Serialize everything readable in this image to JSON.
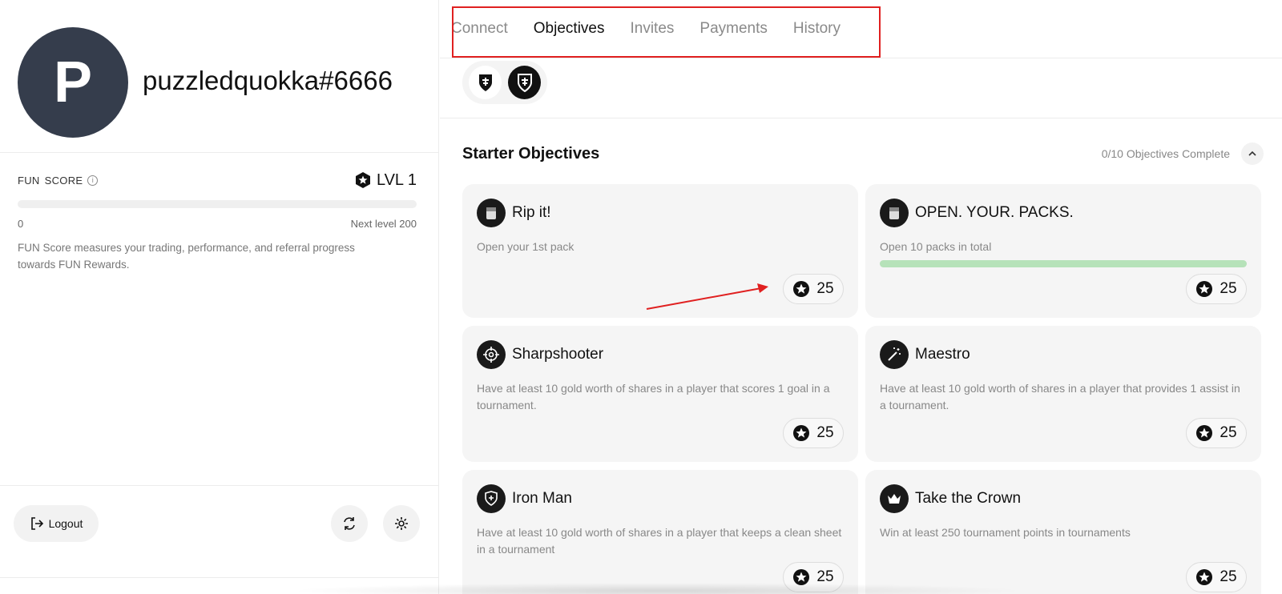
{
  "profile": {
    "avatar_letter": "P",
    "username": "puzzledquokka#6666"
  },
  "fun_score": {
    "label_word1": "FUN",
    "label_word2": "SCORE",
    "level": "LVL 1",
    "min": "0",
    "next_level": "Next level 200",
    "progress_fraction": 0,
    "description": "FUN Score measures your trading, performance, and referral progress towards FUN Rewards."
  },
  "footer": {
    "logout_label": "Logout"
  },
  "tabs": [
    {
      "label": "Connect",
      "active": false
    },
    {
      "label": "Objectives",
      "active": true
    },
    {
      "label": "Invites",
      "active": false
    },
    {
      "label": "Payments",
      "active": false
    },
    {
      "label": "History",
      "active": false
    }
  ],
  "objectives": {
    "title": "Starter Objectives",
    "count": "0/10 Objectives Complete",
    "cards": [
      {
        "title": "Rip it!",
        "desc": "Open your 1st pack",
        "points": "25",
        "icon": "pack-icon"
      },
      {
        "title": "OPEN. YOUR. PACKS.",
        "desc": "Open 10 packs in total",
        "points": "25",
        "icon": "pack-icon",
        "progress_fraction": 1.0
      },
      {
        "title": "Sharpshooter",
        "desc": "Have at least 10 gold worth of shares in a player that scores 1 goal in a tournament.",
        "points": "25",
        "icon": "crosshair-icon"
      },
      {
        "title": "Maestro",
        "desc": "Have at least 10 gold worth of shares in a player that provides 1 assist in a tournament.",
        "points": "25",
        "icon": "magic-wand-icon"
      },
      {
        "title": "Iron Man",
        "desc": "Have at least 10 gold worth of shares in a player that keeps a clean sheet in a tournament",
        "points": "25",
        "icon": "shield-icon"
      },
      {
        "title": "Take the Crown",
        "desc": "Win at least 250 tournament points in tournaments",
        "points": "25",
        "icon": "crown-icon"
      }
    ]
  },
  "colors": {
    "avatar_bg": "#353d4c",
    "highlight_red": "#e02020",
    "progress_green": "#b6e2b9"
  }
}
